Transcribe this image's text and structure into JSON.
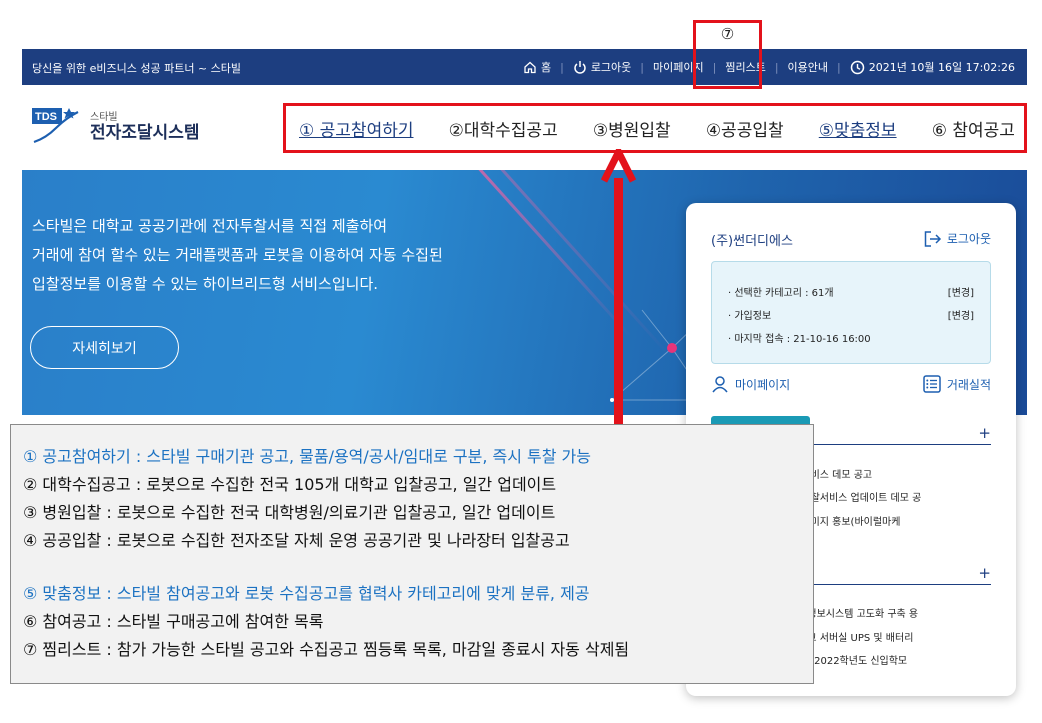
{
  "topbar": {
    "tagline": "당신을 위한 e비즈니스 성공 파트너 ~ 스타빌",
    "items": [
      {
        "label": "홈",
        "icon": "home-icon"
      },
      {
        "label": "로그아웃",
        "icon": "power-icon"
      },
      {
        "label": "마이페이지"
      },
      {
        "label": "찜리스트"
      },
      {
        "label": "이용안내"
      }
    ],
    "datetime": "2021년 10월 16일 17:02:26"
  },
  "marker7": "⑦",
  "logo": {
    "badge": "TDS",
    "small": "스타빌",
    "big": "전자조달시스템"
  },
  "mainnav": [
    "① 공고참여하기",
    "②대학수집공고",
    "③병원입찰",
    "④공공입찰",
    "⑤맞춤정보",
    "⑥ 참여공고"
  ],
  "hero": {
    "lines": [
      "스타빌은 대학교 공공기관에 전자투찰서를 직접 제출하여",
      "거래에 참여 할수 있는 거래플랫폼과 로봇을 이용하여 자동 수집된",
      "입찰정보를 이용할 수 있는 하이브리드형 서비스입니다."
    ],
    "button": "자세히보기"
  },
  "card": {
    "company": "(주)썬더디에스",
    "logout": "로그아웃",
    "info": [
      {
        "label": "· 선택한 카테고리 : 61개",
        "action": "[변경]"
      },
      {
        "label": "· 가입정보",
        "action": "[변경]"
      },
      {
        "label": "· 마지막 접속 : 21-10-16 16:00",
        "action": ""
      }
    ],
    "mypage": "마이페이지",
    "record": "거래실적",
    "plus": "+",
    "news1": [
      "용 서비스 데모 공고",
      "용 입찰서비스 업데이트 데모 공",
      "학 이미지 홍보(바이럴마케"
    ],
    "news2": [
      "종합정보시스템 고도화 구축 용",
      "대학교 서버실 UPS 및 배터리",
      "40호,2022학년도 신입학모"
    ]
  },
  "legend": {
    "group1": [
      {
        "text": "① 공고참여하기 : 스타빌 구매기관 공고, 물품/용역/공사/임대로 구분, 즉시 투찰 가능",
        "blue": true
      },
      {
        "text": "② 대학수집공고 : 로봇으로 수집한 전국 105개 대학교 입찰공고, 일간 업데이트",
        "blue": false
      },
      {
        "text": "③ 병원입찰 : 로봇으로 수집한 전국 대학병원/의료기관 입찰공고, 일간 업데이트",
        "blue": false
      },
      {
        "text": "④ 공공입찰 : 로봇으로 수집한 전자조달 자체 운영 공공기관 및 나라장터 입찰공고",
        "blue": false
      }
    ],
    "group2": [
      {
        "text": "⑤ 맞춤정보 : 스타빌 참여공고와 로봇 수집공고를 협력사 카테고리에 맞게 분류, 제공",
        "blue": true
      },
      {
        "text": "⑥ 참여공고 : 스타빌 구매공고에 참여한 목록",
        "blue": false
      },
      {
        "text": "⑦ 찜리스트 : 참가 가능한 스타빌 공고와 수집공고 찜등록 목록, 마감일 종료시 자동 삭제됨",
        "blue": false
      }
    ]
  },
  "colors": {
    "navy": "#1d3e80",
    "red": "#e3121b",
    "blue": "#1c72c2",
    "teal": "#1a9ab5"
  }
}
